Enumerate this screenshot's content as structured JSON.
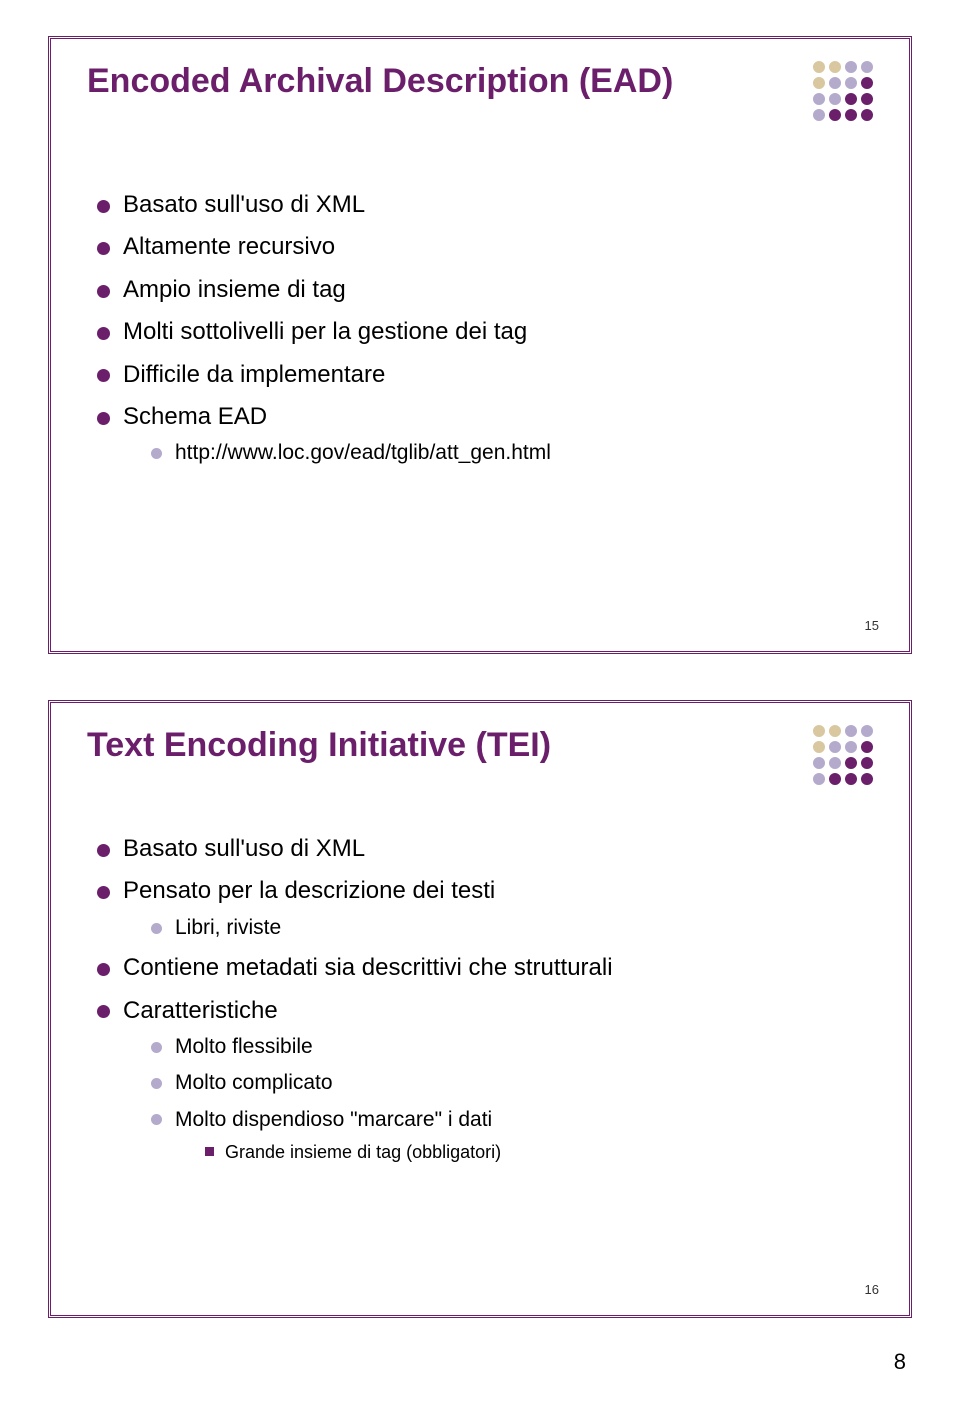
{
  "logo_colors": {
    "c0": "#d9c7a0",
    "c1": "#b4aacc",
    "c2": "#6b1f6b"
  },
  "slide_a": {
    "title": "Encoded Archival Description (EAD)",
    "bullets": [
      {
        "text": "Basato sull'uso di XML"
      },
      {
        "text": "Altamente recursivo"
      },
      {
        "text": "Ampio insieme di tag"
      },
      {
        "text": "Molti sottolivelli per la gestione dei tag"
      },
      {
        "text": "Difficile da implementare"
      },
      {
        "text": "Schema EAD",
        "children": [
          {
            "text": "http://www.loc.gov/ead/tglib/att_gen.html"
          }
        ]
      }
    ],
    "number": "15"
  },
  "slide_b": {
    "title": "Text Encoding Initiative  (TEI)",
    "bullets": [
      {
        "text": "Basato sull'uso di XML"
      },
      {
        "text": "Pensato per la descrizione dei testi",
        "children": [
          {
            "text": "Libri, riviste"
          }
        ]
      },
      {
        "text": "Contiene metadati sia descrittivi che strutturali"
      },
      {
        "text": "Caratteristiche",
        "children": [
          {
            "text": "Molto flessibile"
          },
          {
            "text": "Molto complicato"
          },
          {
            "text": "Molto dispendioso \"marcare\" i dati",
            "children": [
              {
                "text": "Grande insieme di tag (obbligatori)"
              }
            ]
          }
        ]
      }
    ],
    "number": "16"
  },
  "page_number": "8"
}
